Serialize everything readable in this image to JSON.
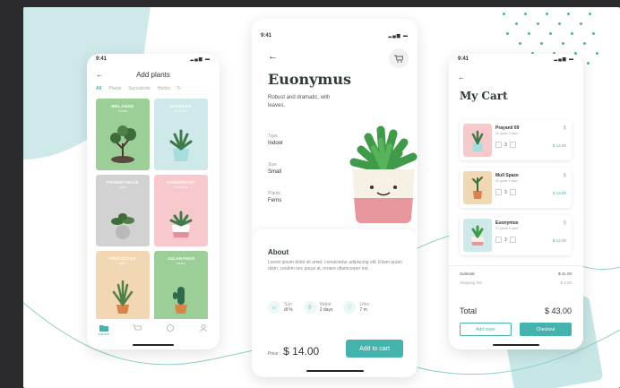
{
  "colors": {
    "accent": "#45b3ad",
    "mint": "#cfe9ea",
    "pink": "#f7c9cd",
    "green": "#9ccf98",
    "grey": "#d2d2d2",
    "tan": "#f1d7b4"
  },
  "plant_list": {
    "status_time": "9:41",
    "title": "Add plants",
    "categories": [
      "All",
      "Plants",
      "Succulents",
      "Herbs",
      "Tr"
    ],
    "cards": [
      {
        "name": "MELANGE",
        "sub": "bonsai"
      },
      {
        "name": "EXCELSA",
        "sub": "succulent"
      },
      {
        "name": "PROMETHEUS",
        "sub": "plant"
      },
      {
        "name": "CANVERANT",
        "sub": "succulent"
      },
      {
        "name": "FRUTICOSA",
        "sub": "plant"
      },
      {
        "name": "JULANTHUS",
        "sub": "cactus"
      }
    ],
    "tabs": [
      {
        "label": "Garden"
      }
    ]
  },
  "detail": {
    "status_time": "9:41",
    "title": "Euonymus",
    "description": "Robust and dramatic, with leaves.",
    "specs": [
      {
        "label": "Type",
        "value": "Indoor"
      },
      {
        "label": "Size",
        "value": "Small"
      },
      {
        "label": "Plants",
        "value": "Ferns"
      }
    ],
    "about_title": "About",
    "about_text": "Lorem ipsum dolor sit amet, consectetur adipiscing elit. Etiam quam diam, condim nec purus at, ornare ullamcorper est.",
    "features": [
      {
        "label": "Sun",
        "value": "dl %"
      },
      {
        "label": "Water",
        "value": "2 days"
      },
      {
        "label": "Lifes",
        "value": "7 m"
      }
    ],
    "price_label": "Price :",
    "price": "$ 14.00",
    "add_to_cart": "Add to cart"
  },
  "cart": {
    "status_time": "9:41",
    "title": "My Cart",
    "items": [
      {
        "name": "Prayanil 69",
        "sub": "50 grade 9 plant",
        "qty": "3",
        "price": "$ 14.00"
      },
      {
        "name": "Mull Spaze",
        "sub": "50 grade 9 plant",
        "qty": "3",
        "price": "$ 14.00"
      },
      {
        "name": "Euonymus",
        "sub": "50 grade 9 plant",
        "qty": "3",
        "price": "$ 14.00"
      }
    ],
    "subtotal_label": "Subtotal",
    "subtotal": "$ 41.00",
    "shipping_label": "Shipping fee",
    "shipping": "$ 2.00",
    "total_label": "Total",
    "total": "$ 43.00",
    "add_more": "Add more",
    "checkout": "Checkout"
  }
}
